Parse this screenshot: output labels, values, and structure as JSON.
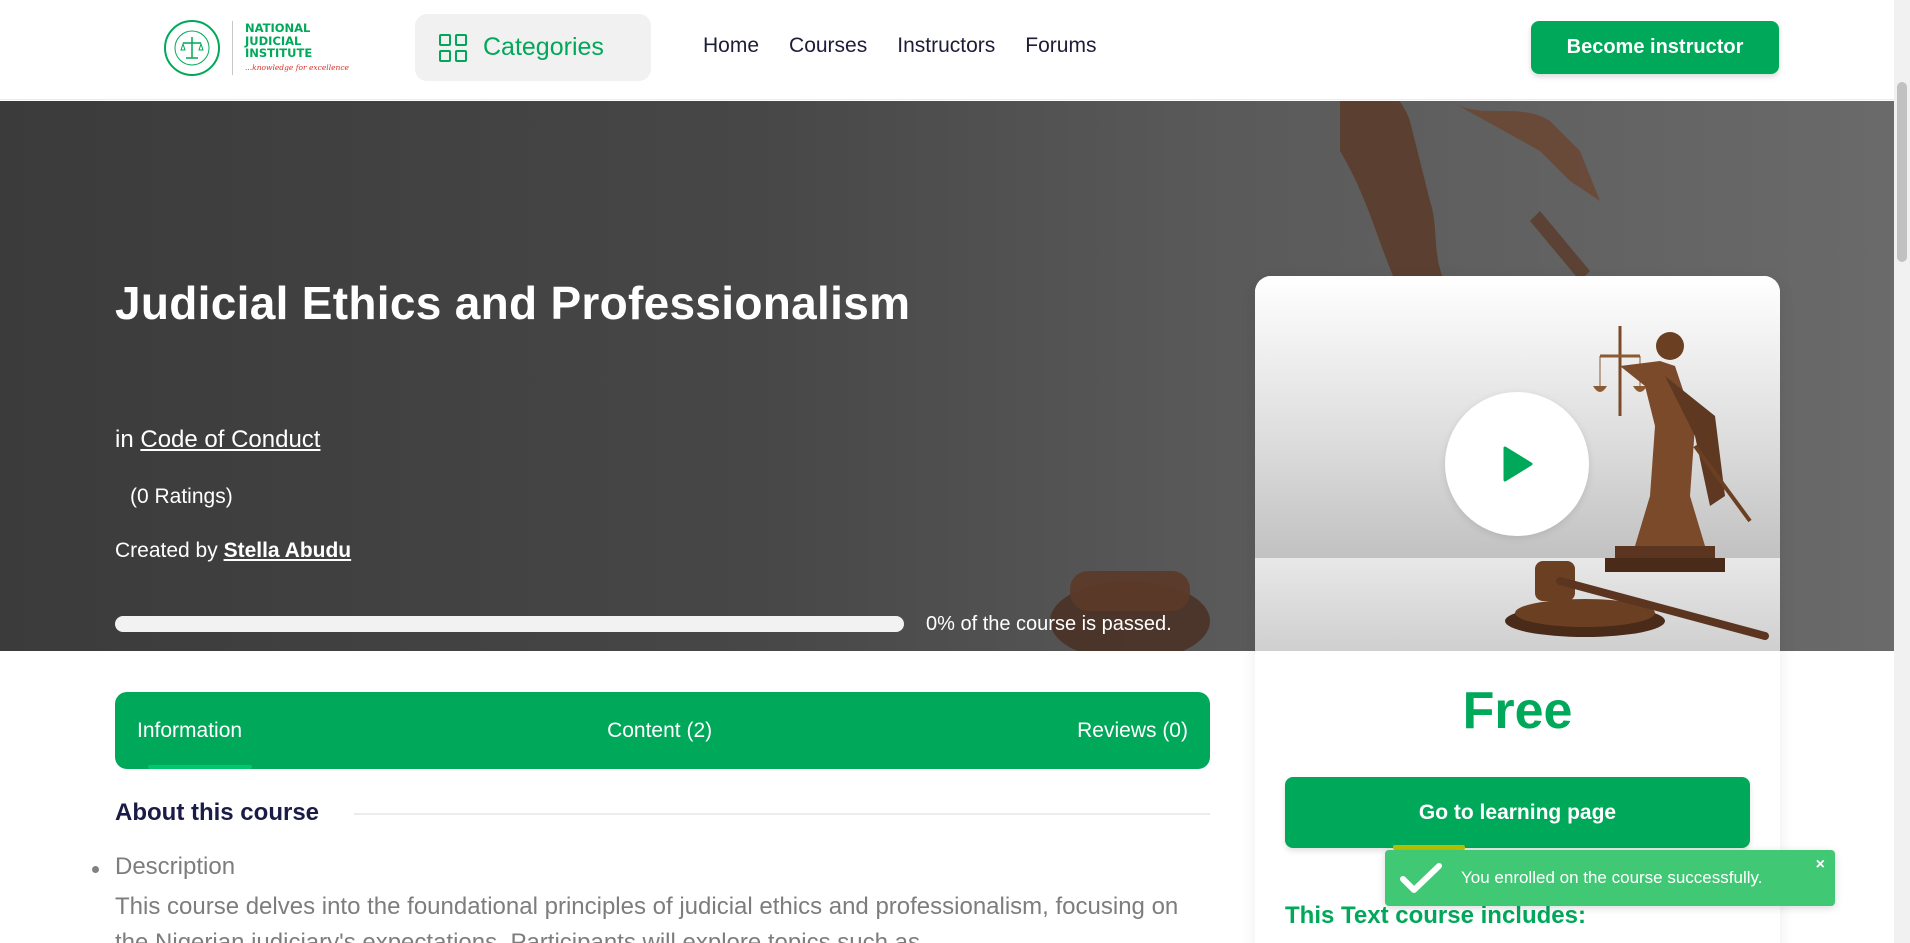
{
  "header": {
    "logo": {
      "line1": "NATIONAL",
      "line2": "JUDICIAL",
      "line3": "INSTITUTE",
      "tagline": "...knowledge for excellence"
    },
    "categories_label": "Categories",
    "nav": [
      "Home",
      "Courses",
      "Instructors",
      "Forums"
    ],
    "become_instructor_label": "Become instructor"
  },
  "hero": {
    "title": "Judicial Ethics and Professionalism",
    "category_prefix": "in",
    "category_link": "Code of Conduct",
    "ratings": "(0 Ratings)",
    "created_by_prefix": "Created by",
    "author": "Stella Abudu",
    "progress_percent": 0,
    "progress_text": "0% of the course is passed."
  },
  "sidebar": {
    "price": "Free",
    "go_to_learning_label": "Go to learning page",
    "includes_heading": "This Text course includes:"
  },
  "tabs": {
    "information": "Information",
    "content": "Content (2)",
    "reviews": "Reviews (0)"
  },
  "about": {
    "heading": "About this course",
    "description_label": "Description",
    "description_text": "This course delves into the foundational principles of judicial ethics and professionalism, focusing on the Nigerian judiciary's expectations. Participants will explore topics such as"
  },
  "toast": {
    "message": "You enrolled on the course successfully.",
    "close": "×"
  },
  "colors": {
    "brand_green": "#00a859",
    "toast_green": "#41c875",
    "hero_dark": "#474747",
    "heading_navy": "#1b1b48"
  },
  "icons": {
    "categories": "grid-icon",
    "play": "play-icon",
    "toast": "check-icon",
    "close": "close-icon"
  }
}
